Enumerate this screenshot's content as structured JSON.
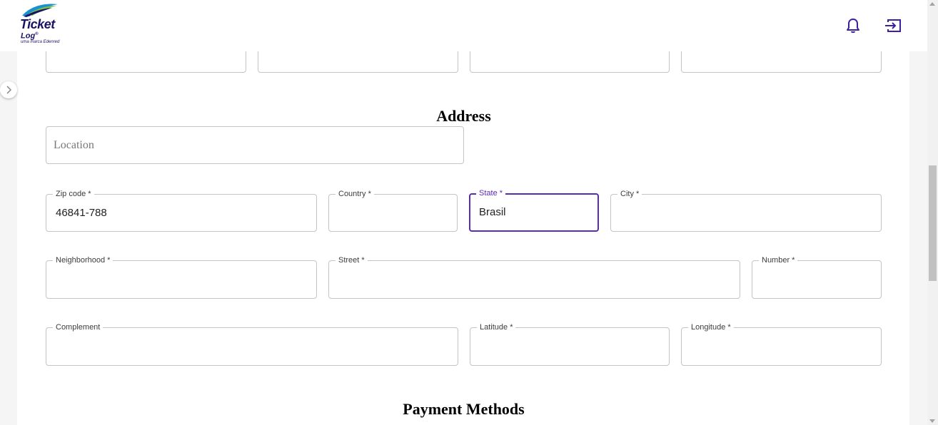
{
  "brand": {
    "name": "Ticket",
    "sub": "Log",
    "reg": "®",
    "tagline": "uma marca Edenred"
  },
  "header": {
    "notification_icon": "bell-icon",
    "logout_icon": "logout-icon"
  },
  "sections": {
    "address_title": "Address",
    "payment_title": "Payment Methods"
  },
  "address": {
    "location_placeholder": "Location",
    "zip": {
      "label": "Zip code *",
      "value": "46841-788"
    },
    "country": {
      "label": "Country *",
      "value": ""
    },
    "state": {
      "label": "State *",
      "value": "Brasil"
    },
    "city": {
      "label": "City *",
      "value": ""
    },
    "neighborhood": {
      "label": "Neighborhood *",
      "value": ""
    },
    "street": {
      "label": "Street *",
      "value": ""
    },
    "number": {
      "label": "Number *",
      "value": ""
    },
    "complement": {
      "label": "Complement",
      "value": ""
    },
    "latitude": {
      "label": "Latitude *",
      "value": ""
    },
    "longitude": {
      "label": "Longitude *",
      "value": ""
    }
  },
  "colors": {
    "accent": "#5b2bb5",
    "brand": "#1b1464"
  }
}
